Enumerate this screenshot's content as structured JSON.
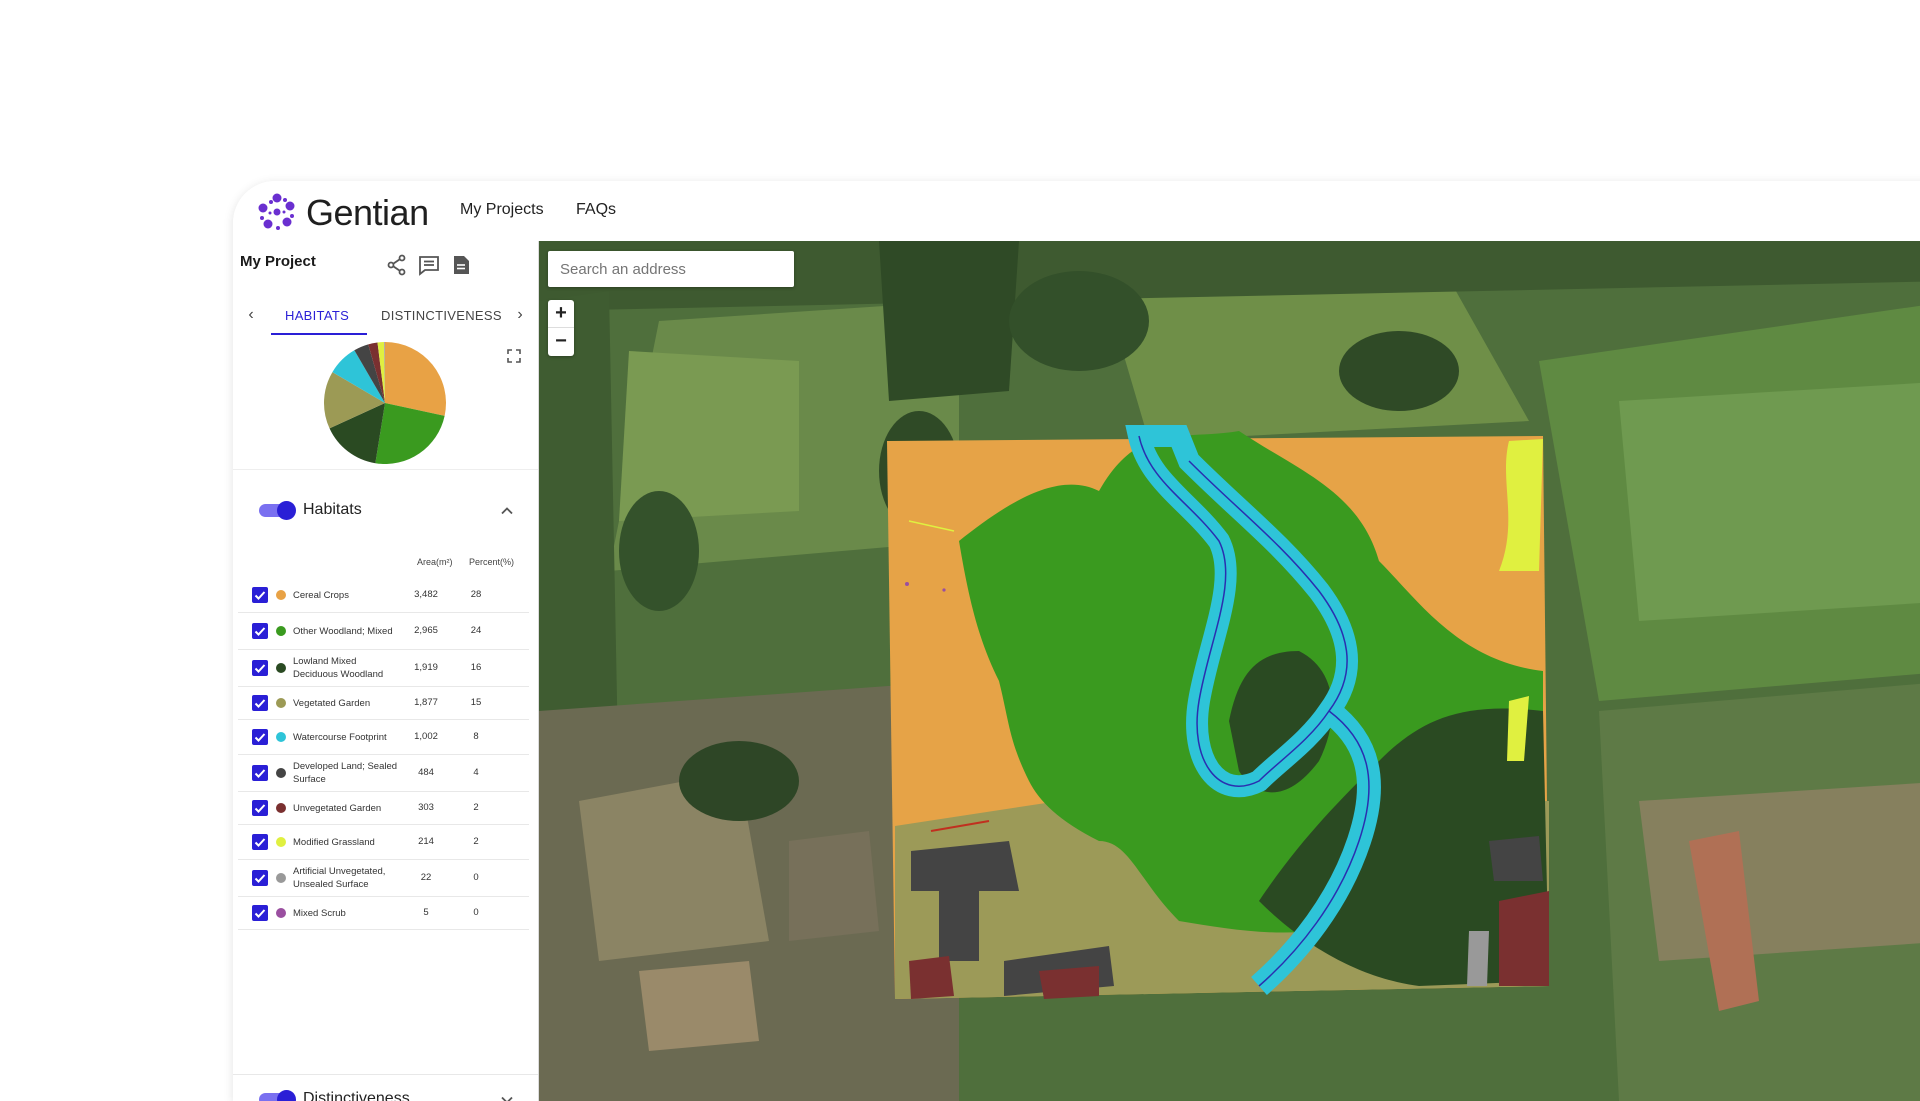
{
  "app": {
    "name": "Gentian",
    "brand_color": "#2a1fd6"
  },
  "nav": {
    "my_projects": "My Projects",
    "faqs": "FAQs"
  },
  "sidebar": {
    "project_title": "My Project",
    "icons": [
      "share-icon",
      "comment-icon",
      "report-icon"
    ],
    "tabs": [
      {
        "label": "HABITATS",
        "active": true
      },
      {
        "label": "DISTINCTIVENESS",
        "active": false
      }
    ],
    "habitats_section": {
      "label": "Habitats",
      "enabled": true,
      "expanded": true
    },
    "distinctiveness_section": {
      "label": "Distinctiveness",
      "enabled": true,
      "expanded": false
    },
    "table": {
      "col_area": "Area(m²)",
      "col_percent": "Percent(%)",
      "rows": [
        {
          "name": "Cereal Crops",
          "area": "3,482",
          "percent": "28",
          "color": "#e8a245",
          "checked": true
        },
        {
          "name": "Other Woodland; Mixed",
          "area": "2,965",
          "percent": "24",
          "color": "#3a9a1f",
          "checked": true
        },
        {
          "name": "Lowland Mixed Deciduous Woodland",
          "area": "1,919",
          "percent": "16",
          "color": "#2a4a22",
          "checked": true
        },
        {
          "name": "Vegetated Garden",
          "area": "1,877",
          "percent": "15",
          "color": "#9c9a55",
          "checked": true
        },
        {
          "name": "Watercourse Footprint",
          "area": "1,002",
          "percent": "8",
          "color": "#2ec4d8",
          "checked": true
        },
        {
          "name": "Developed Land; Sealed Surface",
          "area": "484",
          "percent": "4",
          "color": "#444444",
          "checked": true
        },
        {
          "name": "Unvegetated Garden",
          "area": "303",
          "percent": "2",
          "color": "#7a3030",
          "checked": true
        },
        {
          "name": "Modified Grassland",
          "area": "214",
          "percent": "2",
          "color": "#e0f040",
          "checked": true
        },
        {
          "name": "Artificial Unvegetated, Unsealed Surface",
          "area": "22",
          "percent": "0",
          "color": "#999999",
          "checked": true
        },
        {
          "name": "Mixed Scrub",
          "area": "5",
          "percent": "0",
          "color": "#9a4fa0",
          "checked": true
        }
      ]
    }
  },
  "map": {
    "search": {
      "placeholder": "Search an address",
      "value": ""
    },
    "zoom_in": "+",
    "zoom_out": "−"
  }
}
